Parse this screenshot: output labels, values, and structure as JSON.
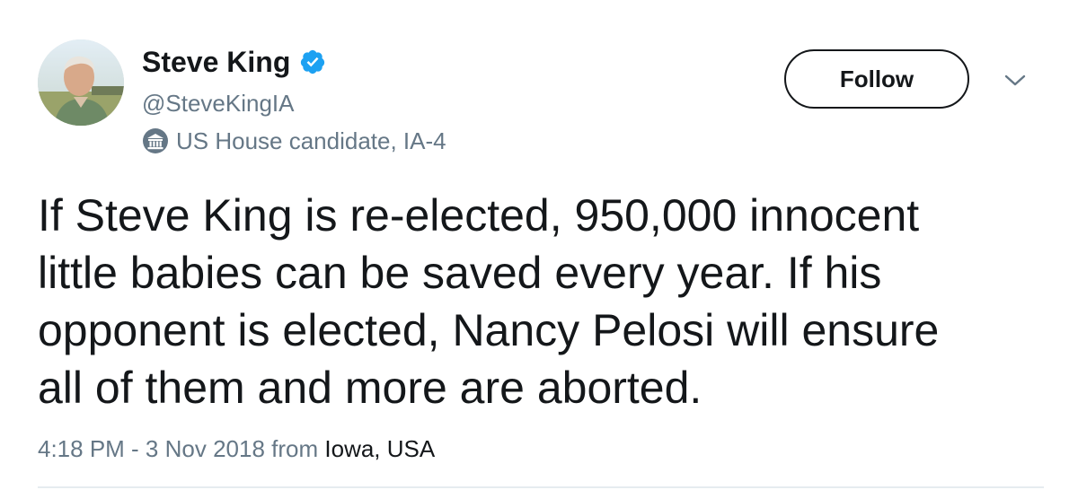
{
  "tweet": {
    "author": {
      "display_name": "Steve King",
      "handle": "@SteveKingIA",
      "verified_icon": "verified-badge-icon",
      "avatar_icon": "profile-photo",
      "label_icon": "government-building-icon",
      "label_text": "US House candidate, IA-4"
    },
    "follow_label": "Follow",
    "caret_icon": "chevron-down-icon",
    "text": "If Steve King is re-elected, 950,000 innocent\nlittle babies can be saved every year. If his\nopponent is elected, Nancy Pelosi will ensure\nall of them and more are aborted.",
    "timestamp": "4:18 PM - 3 Nov 2018",
    "from_word": "from",
    "location": "Iowa, USA"
  },
  "colors": {
    "primary_text": "#14171a",
    "secondary_text": "#657786",
    "verified_blue": "#1da1f2",
    "divider": "#e6ecf0"
  }
}
